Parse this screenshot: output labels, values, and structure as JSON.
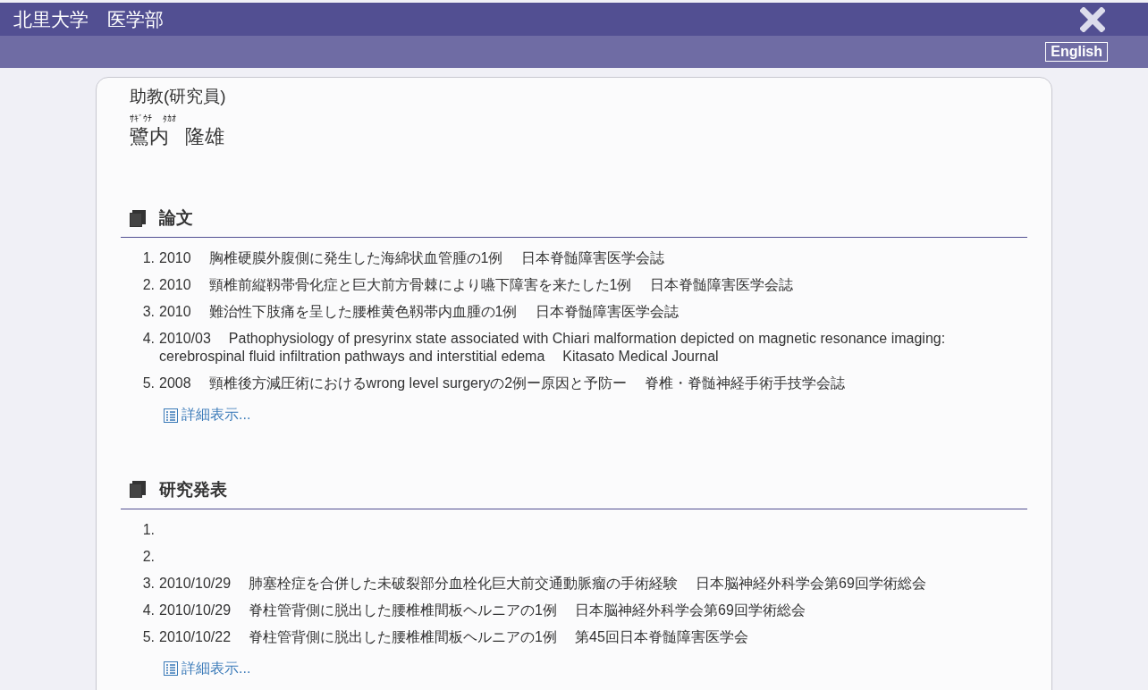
{
  "header": {
    "title": "北里大学　医学部"
  },
  "language_button": "English",
  "profile": {
    "position": "助教(研究員)",
    "reading_family": "ｻｷﾞｳﾁ",
    "reading_given": "ﾀｶｵ",
    "name_family": "鷺内",
    "name_given": "隆雄"
  },
  "sections": [
    {
      "title": "論文",
      "items": [
        {
          "number": "1.",
          "date": "2010",
          "title": "胸椎硬膜外腹側に発生した海綿状血管腫の1例",
          "venue": "日本脊髄障害医学会誌"
        },
        {
          "number": "2.",
          "date": "2010",
          "title": "頸椎前縦靱帯骨化症と巨大前方骨棘により嚥下障害を来たした1例",
          "venue": "日本脊髄障害医学会誌"
        },
        {
          "number": "3.",
          "date": "2010",
          "title": "難治性下肢痛を呈した腰椎黄色靱帯内血腫の1例",
          "venue": "日本脊髄障害医学会誌"
        },
        {
          "number": "4.",
          "date": "2010/03",
          "title": "Pathophysiology of presyrinx state associated with Chiari malformation depicted on magnetic resonance imaging: cerebrospinal fluid infiltration pathways and interstitial edema",
          "venue": "Kitasato Medical Journal"
        },
        {
          "number": "5.",
          "date": "2008",
          "title": "頸椎後方減圧術におけるwrong level surgeryの2例ー原因と予防ー",
          "venue": "脊椎・脊髄神経手術手技学会誌"
        }
      ],
      "more_link": "詳細表示..."
    },
    {
      "title": "研究発表",
      "items": [
        {
          "number": "1."
        },
        {
          "number": "2."
        },
        {
          "number": "3.",
          "date": "2010/10/29",
          "title": "肺塞栓症を合併した未破裂部分血栓化巨大前交通動脈瘤の手術経験",
          "venue": "日本脳神経外科学会第69回学術総会"
        },
        {
          "number": "4.",
          "date": "2010/10/29",
          "title": "脊柱管背側に脱出した腰椎椎間板ヘルニアの1例",
          "venue": "日本脳神経外科学会第69回学術総会"
        },
        {
          "number": "5.",
          "date": "2010/10/22",
          "title": "脊柱管背側に脱出した腰椎椎間板ヘルニアの1例",
          "venue": "第45回日本脊髄障害医学会"
        }
      ],
      "more_link": "詳細表示..."
    }
  ]
}
